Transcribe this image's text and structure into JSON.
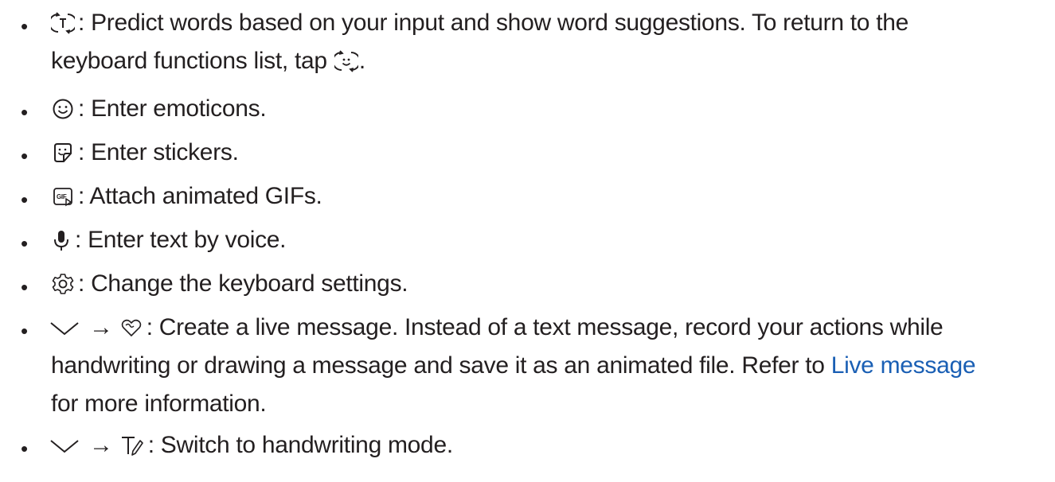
{
  "items": [
    {
      "icon": "predictive-text-icon",
      "line1": ": Predict words based on your input and show word suggestions. To return to the",
      "line2_pre": "keyboard functions list, tap ",
      "line2_icon": "keyboard-functions-icon",
      "line2_post": "."
    },
    {
      "icon": "emoji-icon",
      "text": ": Enter emoticons."
    },
    {
      "icon": "sticker-icon",
      "text": ": Enter stickers."
    },
    {
      "icon": "gif-icon",
      "text": ": Attach animated GIFs."
    },
    {
      "icon": "microphone-icon",
      "text": ": Enter text by voice."
    },
    {
      "icon": "gear-icon",
      "text": ": Change the keyboard settings."
    },
    {
      "icon": "chevron-down-icon",
      "arrow": "→",
      "icon2": "live-message-heart-icon",
      "line1": ": Create a live message. Instead of a text message, record your actions while",
      "line2_pre": "handwriting or drawing a message and save it as an animated file. Refer to ",
      "link": "Live message",
      "line3": "for more information."
    },
    {
      "icon": "chevron-down-icon",
      "arrow": "→",
      "icon2": "handwriting-pen-icon",
      "text": ": Switch to handwriting mode."
    }
  ],
  "bullet": "•",
  "colors": {
    "text": "#231f20",
    "link": "#1a5fb4"
  }
}
